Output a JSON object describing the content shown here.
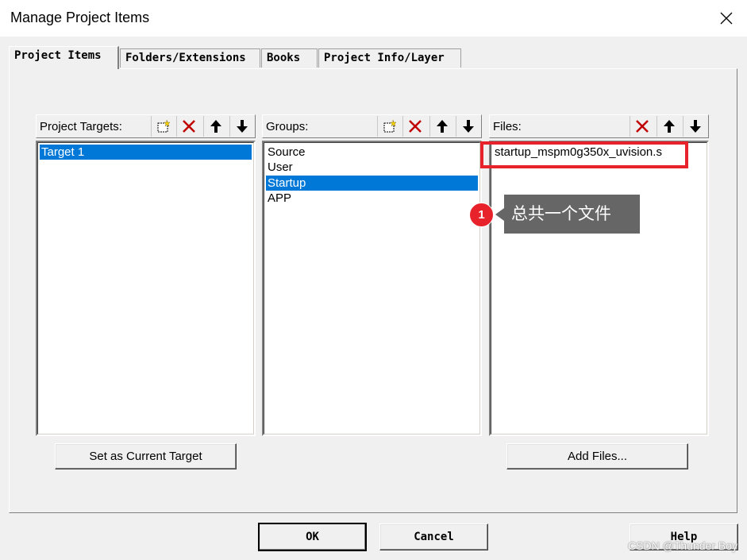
{
  "window": {
    "title": "Manage Project Items"
  },
  "tabs": [
    {
      "label": "Project Items",
      "active": true
    },
    {
      "label": "Folders/Extensions",
      "active": false
    },
    {
      "label": "Books",
      "active": false
    },
    {
      "label": "Project Info/Layer",
      "active": false
    }
  ],
  "targets": {
    "label": "Project Targets:",
    "items": [
      "Target 1"
    ],
    "selected": 0
  },
  "groups": {
    "label": "Groups:",
    "items": [
      "Source",
      "User",
      "Startup",
      "APP"
    ],
    "selected": 2
  },
  "files": {
    "label": "Files:",
    "items": [
      "startup_mspm0g350x_uvision.s"
    ]
  },
  "buttons": {
    "set_current_target": "Set as Current Target",
    "add_files": "Add Files...",
    "ok": "OK",
    "cancel": "Cancel",
    "help": "Help"
  },
  "annotation": {
    "badge": "1",
    "callout": "总共一个文件",
    "color": "#e8222a"
  },
  "watermark": "CSDN @Thunder Boy",
  "colors": {
    "selection": "#0078d7",
    "highlight": "#e8222a"
  },
  "icons": [
    "new-icon",
    "delete-icon",
    "move-up-icon",
    "move-down-icon",
    "close-icon"
  ]
}
